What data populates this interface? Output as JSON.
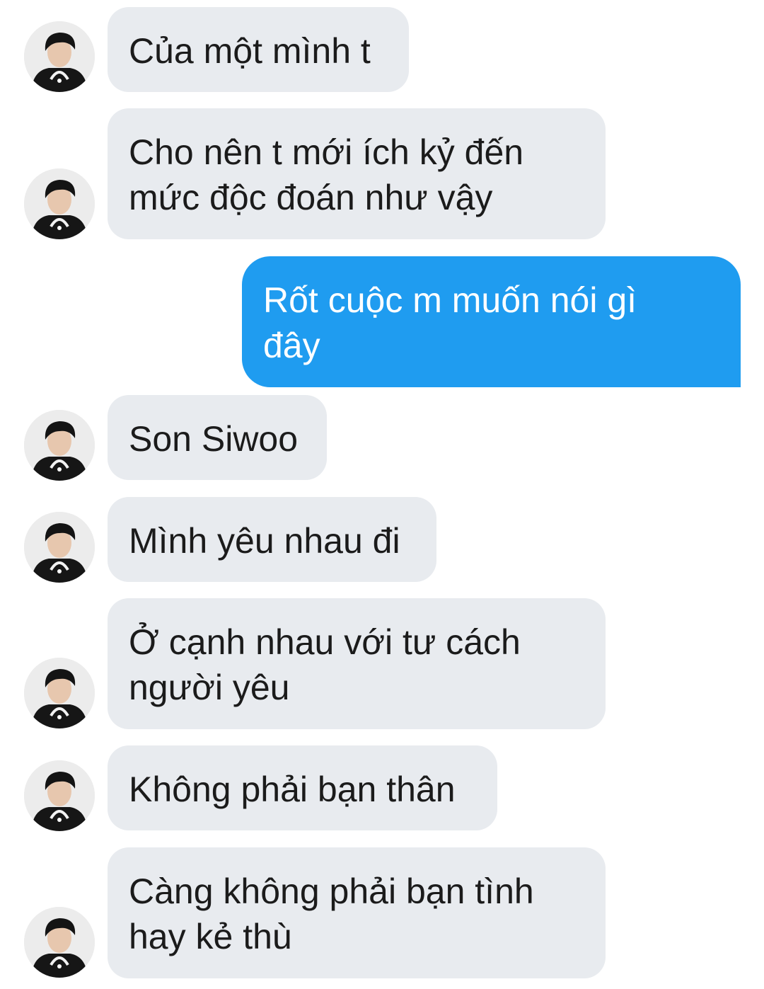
{
  "conversation": {
    "messages": [
      {
        "sender": "them",
        "text": "Của một mình t"
      },
      {
        "sender": "them",
        "text": "Cho nên t mới ích kỷ đến\nmức độc đoán như vậy"
      },
      {
        "sender": "me",
        "text": "Rốt cuộc m muốn nói gì\nđây"
      },
      {
        "sender": "them",
        "text": "Son Siwoo"
      },
      {
        "sender": "them",
        "text": "Mình yêu nhau đi"
      },
      {
        "sender": "them",
        "text": "Ở cạnh nhau với tư cách\nngười yêu"
      },
      {
        "sender": "them",
        "text": "Không phải bạn thân"
      },
      {
        "sender": "them",
        "text": "Càng không phải bạn tình\nhay kẻ thù"
      }
    ]
  },
  "colors": {
    "incoming_bubble": "#e8ebef",
    "outgoing_bubble": "#1f9cf0",
    "incoming_text": "#1b1b1b",
    "outgoing_text": "#ffffff"
  },
  "icons": {
    "contact_avatar": "avatar-photo-icon"
  }
}
